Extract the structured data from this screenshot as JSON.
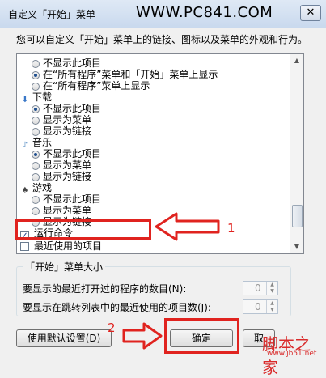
{
  "window": {
    "title": "自定义「开始」菜单",
    "watermark": "WWW.PC841.COM",
    "close_symbol": "✕"
  },
  "description": "您可以自定义「开始」菜单上的链接、图标以及菜单的外观和行为。",
  "list": {
    "items": [
      {
        "kind": "radio",
        "label": "不显示此项目",
        "checked": false
      },
      {
        "kind": "radio",
        "label": "在“所有程序”菜单和「开始」菜单上显示",
        "checked": true
      },
      {
        "kind": "radio",
        "label": "在“所有程序”菜单上显示",
        "checked": false
      },
      {
        "kind": "category",
        "label": "下载",
        "icon": "download-folder-icon"
      },
      {
        "kind": "radio",
        "label": "不显示此项目",
        "checked": true
      },
      {
        "kind": "radio",
        "label": "显示为菜单",
        "checked": false
      },
      {
        "kind": "radio",
        "label": "显示为链接",
        "checked": false
      },
      {
        "kind": "category",
        "label": "音乐",
        "icon": "music-note-icon"
      },
      {
        "kind": "radio",
        "label": "不显示此项目",
        "checked": true
      },
      {
        "kind": "radio",
        "label": "显示为菜单",
        "checked": false
      },
      {
        "kind": "radio",
        "label": "显示为链接",
        "checked": false
      },
      {
        "kind": "category",
        "label": "游戏",
        "icon": "games-icon"
      },
      {
        "kind": "radio",
        "label": "不显示此项目",
        "checked": false
      },
      {
        "kind": "radio",
        "label": "显示为菜单",
        "checked": false
      },
      {
        "kind": "radio",
        "label": "显示为链接",
        "checked": false
      },
      {
        "kind": "checkbox",
        "label": "运行命令",
        "checked": true
      },
      {
        "kind": "checkbox",
        "label": "最近使用的项目",
        "checked": false
      }
    ]
  },
  "size_group": {
    "legend": "「开始」菜单大小",
    "recent_programs_label": "要显示的最近打开过的程序的数目(N):",
    "recent_programs_value": "0",
    "jump_list_label": "要显示在跳转列表中的最近使用的项目数(J):",
    "jump_list_value": "0"
  },
  "buttons": {
    "defaults": "使用默认设置(D)",
    "ok": "确定",
    "cancel": "取"
  },
  "annotations": {
    "step1": "1",
    "step2": "2"
  },
  "logo": {
    "main": "脚本之家",
    "sub": "www.jb51.net"
  },
  "colors": {
    "annotation_red": "#e0231f"
  }
}
